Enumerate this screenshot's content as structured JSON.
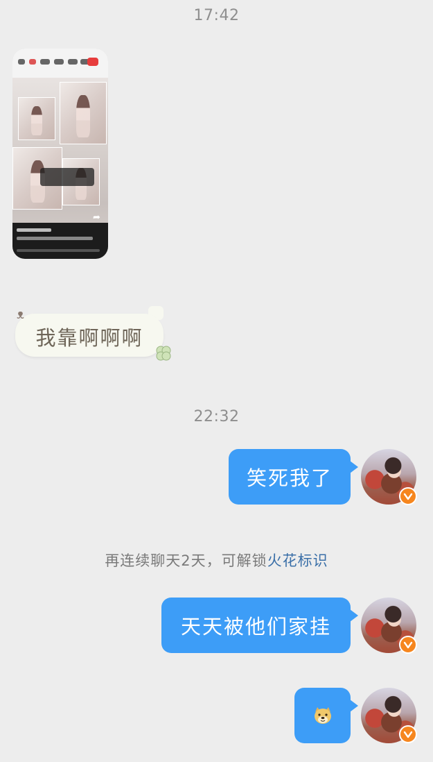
{
  "timestamps": [
    "17:42",
    "22:32"
  ],
  "messages": {
    "left_text": "我靠啊啊啊",
    "right_1": "笑死我了",
    "right_2": "天天被他们家挂",
    "right_3_emoji": "doge-emoji"
  },
  "system_note": {
    "text": "再连续聊天2天，可解锁",
    "link": "火花标识"
  },
  "icons": {
    "verified": "verified-badge-icon",
    "bow": "bow-icon",
    "clover": "clover-icon"
  },
  "colors": {
    "background": "#EDEDED",
    "bubble_blue": "#3D9DF7",
    "link_blue": "#3A6FA8",
    "verified_orange": "#F6861E"
  }
}
